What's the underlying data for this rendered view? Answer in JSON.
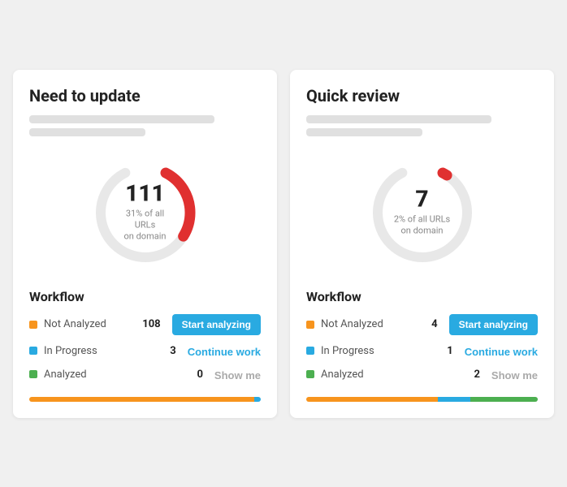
{
  "cards": [
    {
      "title": "Need to update",
      "count": "111",
      "pct_label": "31% of all URLs\non domain",
      "donut_pct": 31,
      "donut_color": "#e03030",
      "workflow_title": "Workflow",
      "rows": [
        {
          "dot": "orange",
          "label": "Not Analyzed",
          "count": "108",
          "action_type": "btn",
          "action_label": "Start analyzing"
        },
        {
          "dot": "blue",
          "label": "In Progress",
          "count": "3",
          "action_type": "link",
          "action_label": "Continue work"
        },
        {
          "dot": "green",
          "label": "Analyzed",
          "count": "0",
          "action_type": "link-muted",
          "action_label": "Show me"
        }
      ],
      "progress": [
        {
          "color": "orange",
          "pct": 97.3
        },
        {
          "color": "blue",
          "pct": 2.7
        },
        {
          "color": "green",
          "pct": 0
        }
      ]
    },
    {
      "title": "Quick review",
      "count": "7",
      "pct_label": "2% of all URLs\non domain",
      "donut_pct": 2,
      "donut_color": "#e03030",
      "workflow_title": "Workflow",
      "rows": [
        {
          "dot": "orange",
          "label": "Not Analyzed",
          "count": "4",
          "action_type": "btn",
          "action_label": "Start analyzing"
        },
        {
          "dot": "blue",
          "label": "In Progress",
          "count": "1",
          "action_type": "link",
          "action_label": "Continue work"
        },
        {
          "dot": "green",
          "label": "Analyzed",
          "count": "2",
          "action_type": "link-muted",
          "action_label": "Show me"
        }
      ],
      "progress": [
        {
          "color": "orange",
          "pct": 57
        },
        {
          "color": "blue",
          "pct": 14
        },
        {
          "color": "green",
          "pct": 29
        }
      ]
    }
  ]
}
